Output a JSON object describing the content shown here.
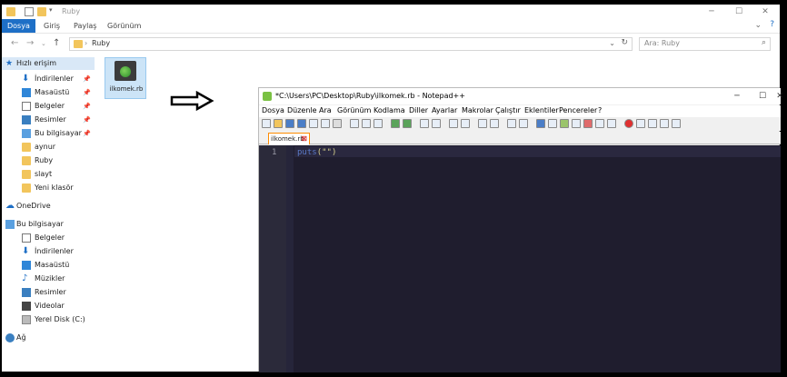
{
  "explorer": {
    "title": "Ruby",
    "ribbon_tabs": [
      "Dosya",
      "Giriş",
      "Paylaş",
      "Görünüm"
    ],
    "address": "Ruby",
    "search_placeholder": "Ara: Ruby",
    "quick_access": "Hızlı erişim",
    "sidebar": [
      {
        "label": "İndirilenler",
        "pinned": true
      },
      {
        "label": "Masaüstü",
        "pinned": true
      },
      {
        "label": "Belgeler",
        "pinned": true
      },
      {
        "label": "Resimler",
        "pinned": true
      },
      {
        "label": "Bu bilgisayar",
        "pinned": true
      },
      {
        "label": "aynur",
        "pinned": false
      },
      {
        "label": "Ruby",
        "pinned": false
      },
      {
        "label": "slayt",
        "pinned": false
      },
      {
        "label": "Yeni klasör",
        "pinned": false
      }
    ],
    "onedrive": "OneDrive",
    "this_pc": "Bu bilgisayar",
    "pc_items": [
      "Belgeler",
      "İndirilenler",
      "Masaüstü",
      "Müzikler",
      "Resimler",
      "Videolar",
      "Yerel Disk (C:)"
    ],
    "network": "Ağ",
    "file": "ilkomek.rb"
  },
  "notepad": {
    "title": "*C:\\Users\\PC\\Desktop\\Ruby\\ilkomek.rb - Notepad++",
    "menu": [
      "Dosya",
      "Düzenle",
      "Ara",
      "Görünüm",
      "Kodlama",
      "Diller",
      "Ayarlar",
      "Makrolar",
      "Çalıştır",
      "Eklentiler",
      "Pencereler",
      "?"
    ],
    "tab": "ilkomek.rb",
    "line_number": "1",
    "code_keyword": "puts",
    "code_string": "(\"\")"
  }
}
